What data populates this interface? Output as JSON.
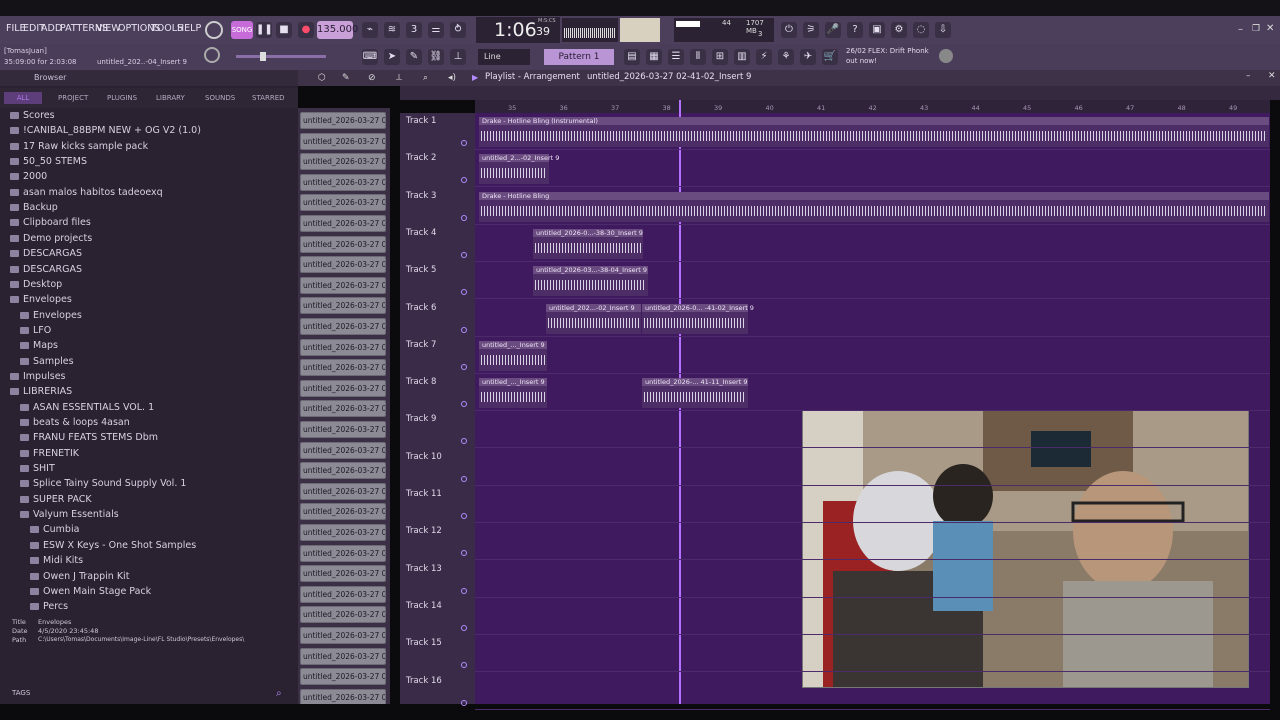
{
  "menu": [
    "FILE",
    "EDIT",
    "ADD",
    "PATTERNS",
    "VIEW",
    "OPTIONS",
    "TOOLS",
    "HELP"
  ],
  "transport": {
    "tempo": "135.000",
    "time": "1:06",
    "time_sub": "39",
    "time_label": "M:S:CS",
    "cpu": "44",
    "ram": "1707 MB",
    "poly": "3"
  },
  "toolbar": {
    "snap": "Line",
    "pattern": "Pattern 1"
  },
  "hint": {
    "user": "[TomasJuan]",
    "project": "untitled_202..-04_Insert 9",
    "time": "35:09:00 for 2:03:08"
  },
  "news": {
    "date": "26/02",
    "text": "FLEX: Drift Phonk",
    "text2": "out now!"
  },
  "playlist": {
    "title": "Playlist - Arrangement",
    "crumb": "untitled_2026-03-27 02-41-02_Insert 9"
  },
  "browser": {
    "title": "Browser",
    "tabs": [
      "ALL",
      "PROJECT",
      "PLUGINS",
      "LIBRARY",
      "SOUNDS",
      "STARRED"
    ],
    "items": [
      {
        "label": "Scores",
        "lvl": 0
      },
      {
        "label": "!CANIBAL_88BPM NEW + OG V2 (1.0)",
        "lvl": 0
      },
      {
        "label": "17 Raw kicks sample pack",
        "lvl": 0
      },
      {
        "label": "50_50 STEMS",
        "lvl": 0
      },
      {
        "label": "2000",
        "lvl": 0
      },
      {
        "label": "asan malos habitos tadeoexq",
        "lvl": 0
      },
      {
        "label": "Backup",
        "lvl": 0
      },
      {
        "label": "Clipboard files",
        "lvl": 0
      },
      {
        "label": "Demo projects",
        "lvl": 0
      },
      {
        "label": "DESCARGAS",
        "lvl": 0
      },
      {
        "label": "DESCARGAS",
        "lvl": 0
      },
      {
        "label": "Desktop",
        "lvl": 0
      },
      {
        "label": "Envelopes",
        "lvl": 0
      },
      {
        "label": "Envelopes",
        "lvl": 1
      },
      {
        "label": "LFO",
        "lvl": 1
      },
      {
        "label": "Maps",
        "lvl": 1
      },
      {
        "label": "Samples",
        "lvl": 1
      },
      {
        "label": "Impulses",
        "lvl": 0
      },
      {
        "label": "LIBRERIAS",
        "lvl": 0
      },
      {
        "label": "ASAN ESSENTIALS VOL. 1",
        "lvl": 1
      },
      {
        "label": "beats & loops 4asan",
        "lvl": 1
      },
      {
        "label": "FRANU FEATS STEMS Dbm",
        "lvl": 1
      },
      {
        "label": "FRENETIK",
        "lvl": 1
      },
      {
        "label": "SHIT",
        "lvl": 1
      },
      {
        "label": "Splice Tainy Sound Supply Vol. 1",
        "lvl": 1
      },
      {
        "label": "SUPER PACK",
        "lvl": 1
      },
      {
        "label": "Valyum Essentials",
        "lvl": 1
      },
      {
        "label": "Cumbia",
        "lvl": 2
      },
      {
        "label": "ESW X Keys - One Shot Samples",
        "lvl": 2
      },
      {
        "label": "Midi Kits",
        "lvl": 2
      },
      {
        "label": "Owen J Trappin Kit",
        "lvl": 2
      },
      {
        "label": "Owen Main Stage Pack",
        "lvl": 2
      },
      {
        "label": "Percs",
        "lvl": 2
      }
    ],
    "info": {
      "title_label": "Title",
      "title": "Envelopes",
      "date_label": "Date",
      "date": "4/5/2020 23:45:48",
      "path_label": "Path",
      "path": "C:\\Users\\Tomas\\Documents\\Image-Line\\FL Studio\\Presets\\Envelopes\\"
    },
    "tags": "TAGS"
  },
  "clip_label": "untitled_2026-03-27 02-",
  "ruler": [
    "35",
    "36",
    "37",
    "38",
    "39",
    "40",
    "41",
    "42",
    "43",
    "44",
    "45",
    "46",
    "47",
    "48",
    "49"
  ],
  "tracks": [
    "Track 1",
    "Track 2",
    "Track 3",
    "Track 4",
    "Track 5",
    "Track 6",
    "Track 7",
    "Track 8",
    "Track 9",
    "Track 10",
    "Track 11",
    "Track 12",
    "Track 13",
    "Track 14",
    "Track 15",
    "Track 16"
  ],
  "clips": [
    {
      "label": "Drake - Hotline Bling (Instrumental)",
      "track": 0
    },
    {
      "label": "untitled_2...-02_Insert 9",
      "track": 1
    },
    {
      "label": "Drake - Hotline Bling",
      "track": 2
    },
    {
      "label": "untitled_2026-0...-38-30_Insert 9",
      "track": 3
    },
    {
      "label": "untitled_2026-03...-38-04_Insert 9",
      "track": 4
    },
    {
      "label": "untitled_202...-02_Insert 9",
      "track": 5
    },
    {
      "label": "untitled_2026-0... -41-02_Insert 9",
      "track": 5
    },
    {
      "label": "untitled_..._Insert 9",
      "track": 6
    },
    {
      "label": "untitled_..._Insert 9",
      "track": 7
    },
    {
      "label": "untitled_2026-... 41-11_Insert 9",
      "track": 7
    }
  ],
  "colors": {
    "accent": "#b470ff",
    "lane": "#3f1a5e",
    "menubar": "#4b3f5c"
  }
}
